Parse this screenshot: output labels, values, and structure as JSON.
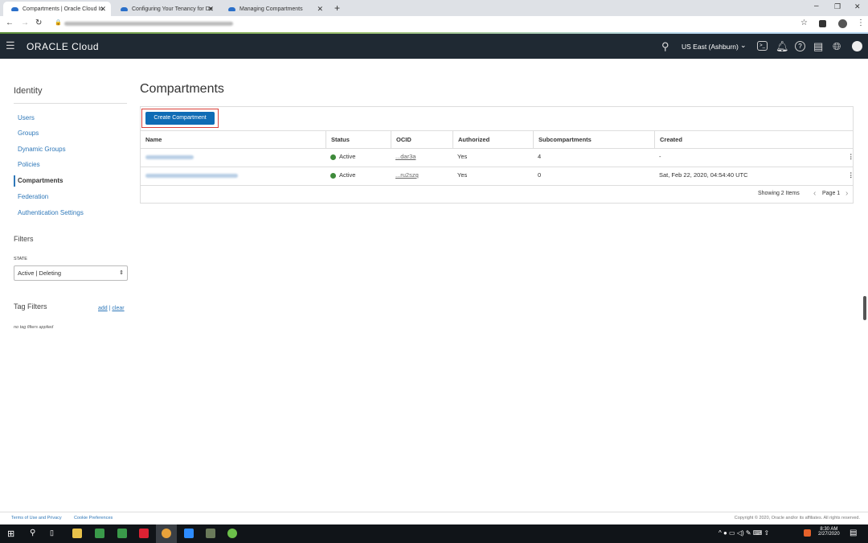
{
  "browser": {
    "tabs": [
      {
        "label": "Compartments | Oracle Cloud In"
      },
      {
        "label": "Configuring Your Tenancy for De"
      },
      {
        "label": "Managing Compartments"
      }
    ],
    "new_tab": "+"
  },
  "header": {
    "logo": "ORACLE Cloud",
    "region": "US East (Ashburn)",
    "icons": [
      "search-icon",
      "cloud-shell-icon",
      "bell-icon",
      "help-icon",
      "chat-icon",
      "globe-icon",
      "user-icon"
    ]
  },
  "sidebar": {
    "title": "Identity",
    "items": [
      {
        "label": "Users"
      },
      {
        "label": "Groups"
      },
      {
        "label": "Dynamic Groups"
      },
      {
        "label": "Policies"
      },
      {
        "label": "Compartments",
        "active": true
      },
      {
        "label": "Federation"
      },
      {
        "label": "Authentication Settings"
      }
    ],
    "filters_title": "Filters",
    "state_label": "STATE",
    "state_value": "Active | Deleting",
    "tag_filters_title": "Tag Filters",
    "tag_add": "add",
    "tag_sep": "|",
    "tag_clear": "clear",
    "tag_empty": "no tag filters applied"
  },
  "main": {
    "title": "Compartments",
    "create_button": "Create Compartment",
    "columns": [
      "Name",
      "Status",
      "OCID",
      "Authorized",
      "Subcompartments",
      "Created"
    ],
    "rows": [
      {
        "status": "Active",
        "ocid": "...dar3a",
        "authorized": "Yes",
        "subcompartments": "4",
        "created": "-"
      },
      {
        "status": "Active",
        "ocid": "...ru2szq",
        "authorized": "Yes",
        "subcompartments": "0",
        "created": "Sat, Feb 22, 2020, 04:54:40 UTC"
      }
    ],
    "showing": "Showing 2 Items",
    "page": "Page 1"
  },
  "footer": {
    "terms": "Terms of Use and Privacy",
    "cookies": "Cookie Preferences",
    "copyright": "Copyright © 2020, Oracle and/or its affiliates. All rights reserved."
  },
  "taskbar": {
    "time": "8:30 AM",
    "date": "2/27/2020"
  },
  "colors": {
    "accent": "#2f78b9",
    "header": "#1f2933",
    "active": "#3e8a3a",
    "button": "#0f6cb5",
    "highlight": "#d9403a"
  }
}
